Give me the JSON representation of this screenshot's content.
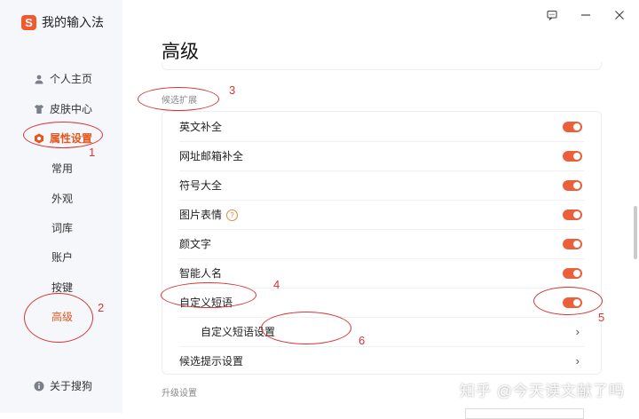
{
  "app": {
    "name": "我的输入法"
  },
  "sidebar": {
    "items": [
      {
        "label": "个人主页",
        "icon": "person-icon"
      },
      {
        "label": "皮肤中心",
        "icon": "shirt-icon"
      },
      {
        "label": "属性设置",
        "icon": "hexagon-settings-icon"
      }
    ],
    "sub_items": [
      "常用",
      "外观",
      "词库",
      "账户",
      "按键",
      "高级"
    ],
    "about": {
      "label": "关于搜狗",
      "icon": "info-icon"
    }
  },
  "window": {
    "buttons": [
      "feedback-icon",
      "minimize-icon",
      "close-icon"
    ]
  },
  "main": {
    "title": "高级",
    "section_label": "候选扩展",
    "rows": [
      {
        "label": "英文补全",
        "toggle": true
      },
      {
        "label": "网址邮箱补全",
        "toggle": true
      },
      {
        "label": "符号大全",
        "toggle": true
      },
      {
        "label": "图片表情",
        "toggle": true,
        "help": "?"
      },
      {
        "label": "颜文字",
        "toggle": true
      },
      {
        "label": "智能人名",
        "toggle": true
      },
      {
        "label": "自定义短语",
        "toggle": true
      },
      {
        "label": "自定义短语设置",
        "chevron": "›"
      },
      {
        "label": "候选提示设置",
        "chevron": "›"
      }
    ],
    "upgrade_label": "升级设置"
  },
  "annotations": [
    "1",
    "2",
    "3",
    "4",
    "5",
    "6"
  ],
  "watermark": "知乎 @今天读文献了吗",
  "colors": {
    "accent": "#e4571f",
    "toggle_on": "#ec5f3b",
    "annotation": "#d93434"
  }
}
